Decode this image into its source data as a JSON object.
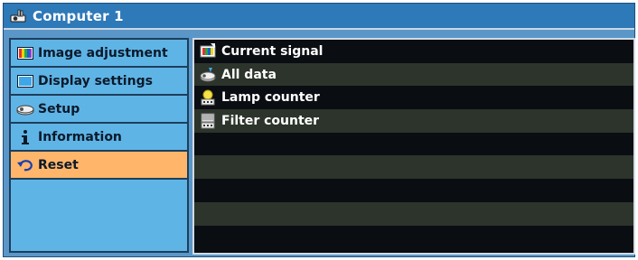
{
  "window": {
    "title": "Computer 1",
    "title_icon": "projector-icon"
  },
  "sidebar": {
    "items": [
      {
        "label": "Image adjustment",
        "icon": "palette-icon",
        "active": false
      },
      {
        "label": "Display settings",
        "icon": "screen-icon",
        "active": false
      },
      {
        "label": "Setup",
        "icon": "projector-setup-icon",
        "active": false
      },
      {
        "label": "Information",
        "icon": "info-icon",
        "active": false
      },
      {
        "label": "Reset",
        "icon": "undo-icon",
        "active": true
      }
    ]
  },
  "content": {
    "items": [
      {
        "label": "Current signal",
        "icon": "signal-icon"
      },
      {
        "label": "All data",
        "icon": "all-data-icon"
      },
      {
        "label": "Lamp counter",
        "icon": "lamp-counter-icon"
      },
      {
        "label": "Filter counter",
        "icon": "filter-counter-icon"
      }
    ]
  },
  "colors": {
    "titlebar": "#2e79b8",
    "sidebar_bg": "#5fb4e6",
    "active_item": "#ffb66b",
    "content_bg": "#0a0d12",
    "content_alt_row": "#2c342b"
  }
}
